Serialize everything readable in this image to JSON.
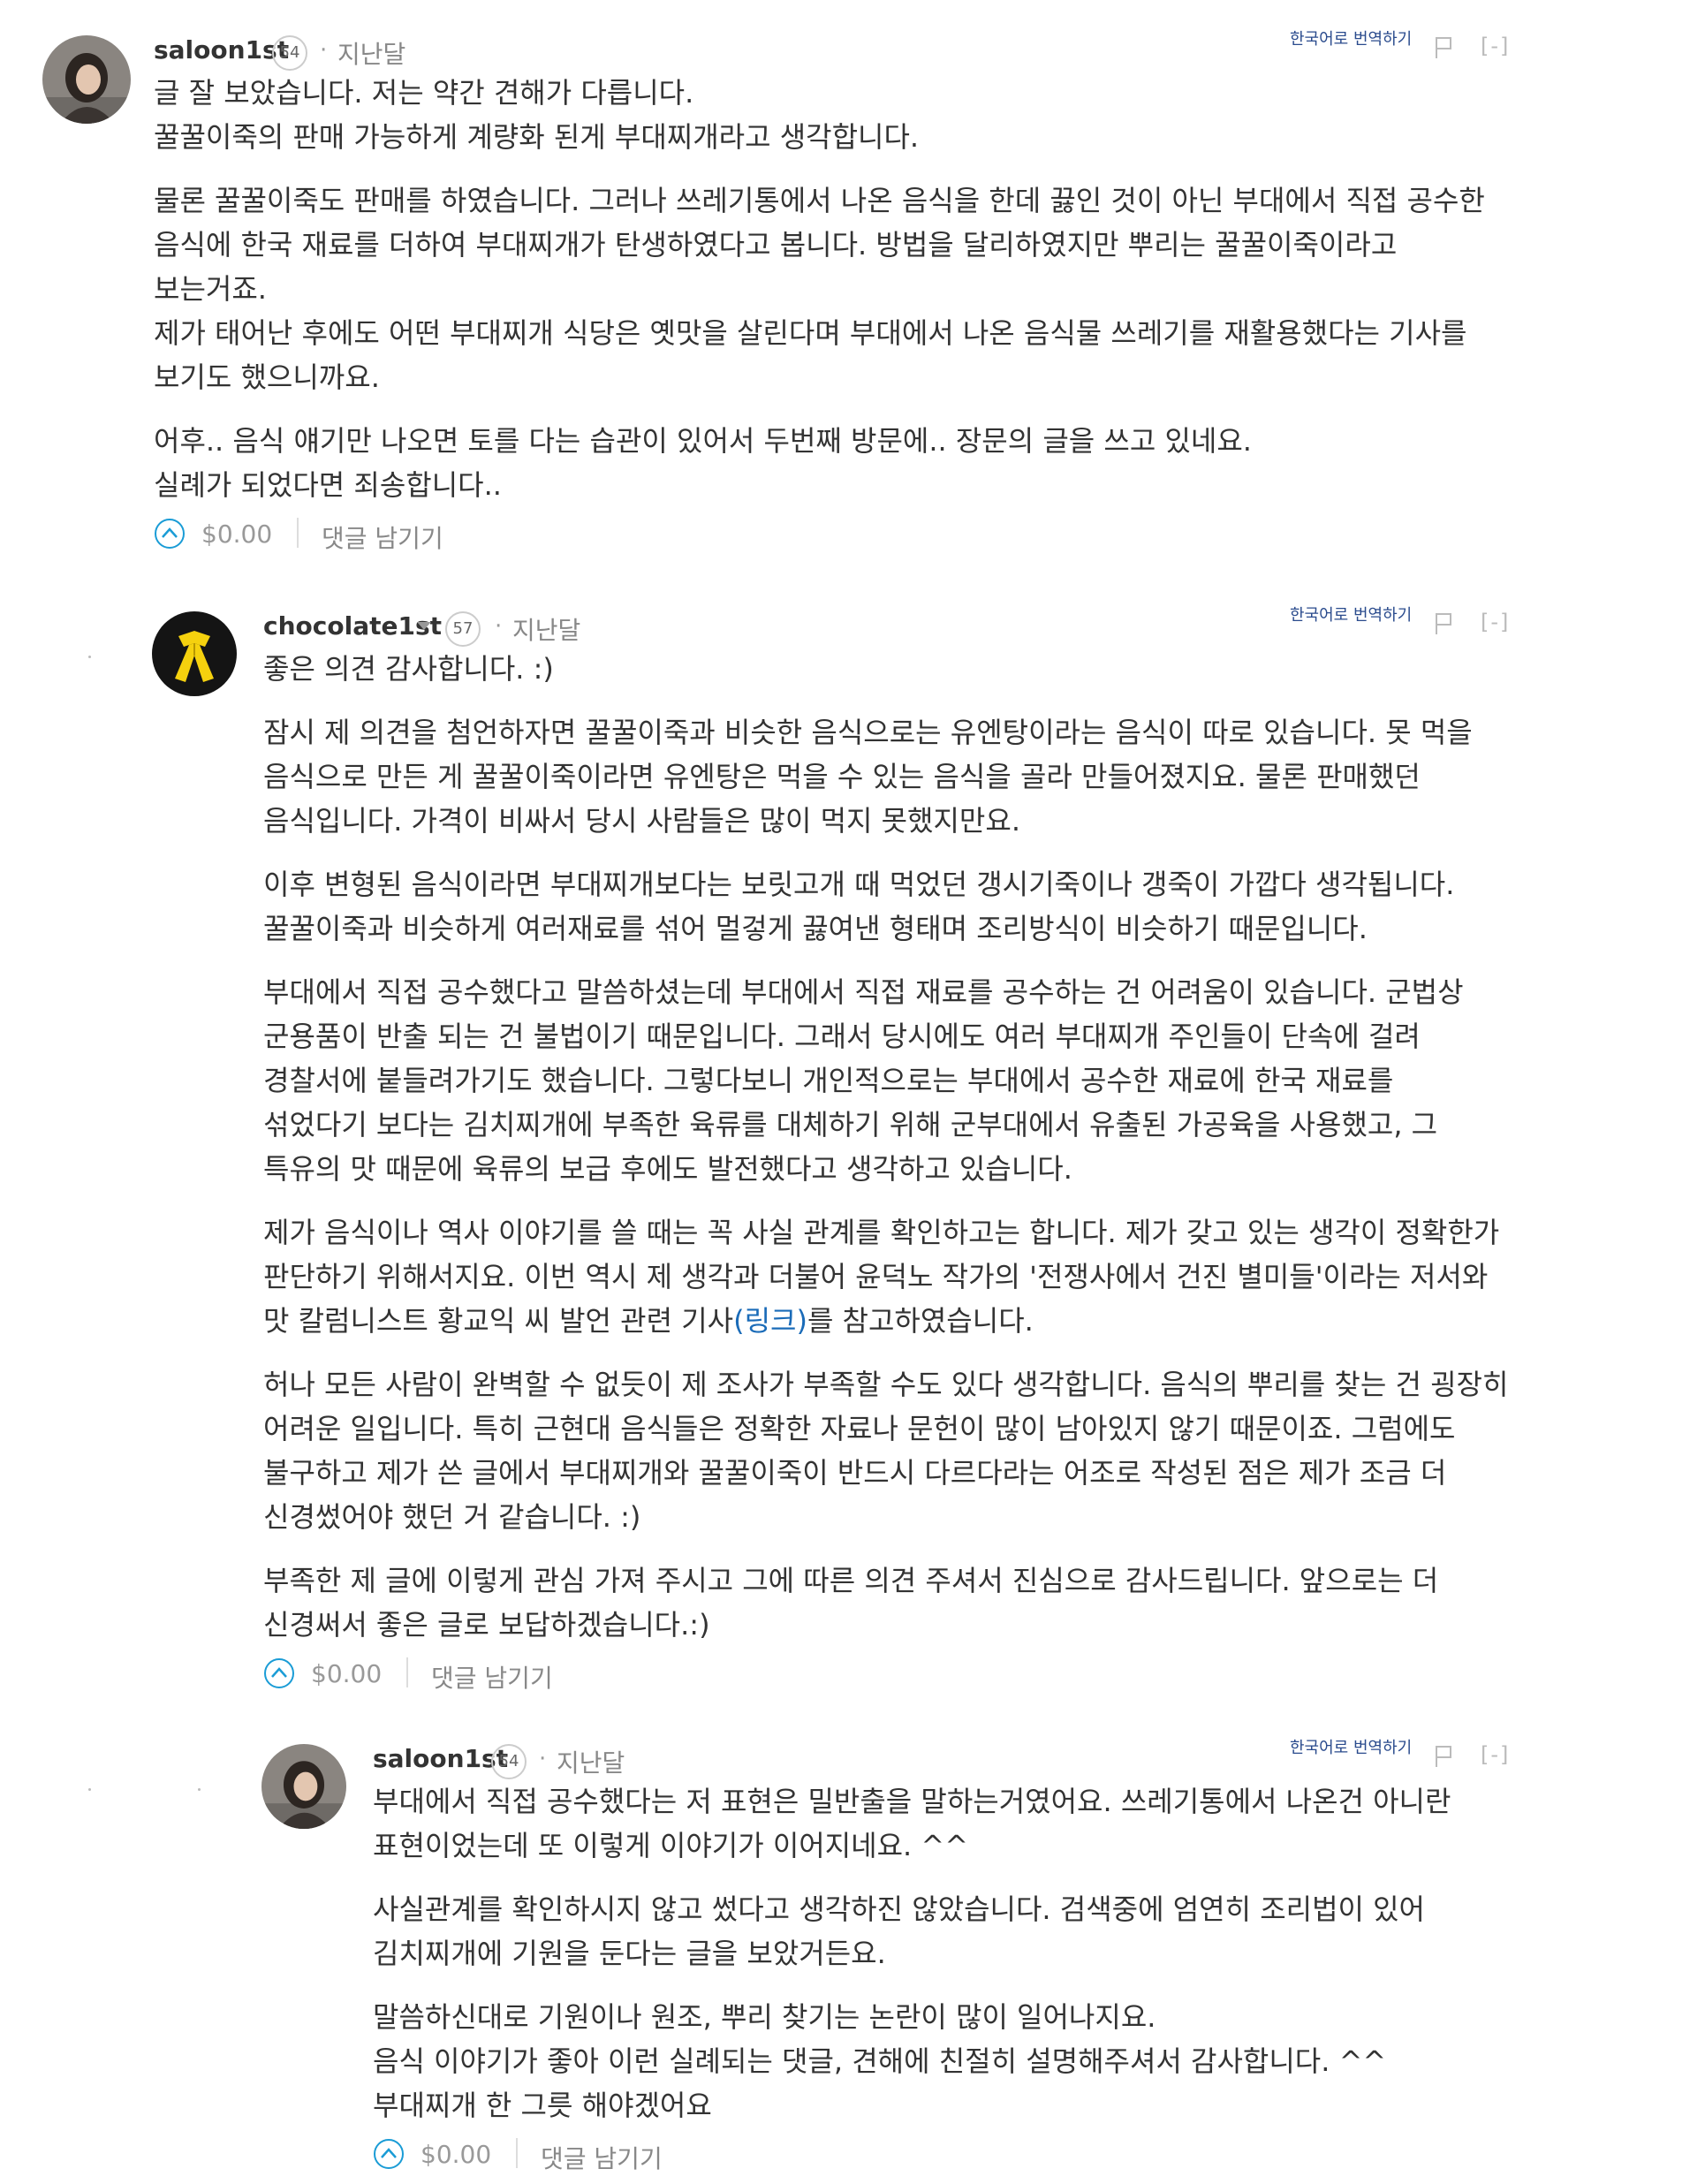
{
  "comments": [
    {
      "author": "saloon1st",
      "reputation": "54",
      "separator": "·",
      "time": "지난달",
      "translate": "한국어로 번역하기",
      "collapse": "[-]",
      "avatar_icon": "user-photo-avatar",
      "body_lines": [
        "글 잘 보았습니다. 저는 약간 견해가 다릅니다.",
        "꿀꿀이죽의 판매 가능하게 계량화 된게 부대찌개라고 생각합니다.",
        "물론 꿀꿀이죽도 판매를 하였습니다. 그러나 쓰레기통에서 나온 음식을 한데 끓인 것이 아닌 부대에서 직접 공수한",
        "음식에 한국 재료를 더하여 부대찌개가 탄생하였다고 봅니다. 방법을 달리하였지만 뿌리는 꿀꿀이죽이라고",
        "보는거죠.",
        "제가 태어난 후에도 어떤 부대찌개 식당은 옛맛을 살린다며 부대에서 나온 음식물 쓰레기를 재활용했다는 기사를",
        "보기도 했으니까요.",
        "어후.. 음식 얘기만 나오면 토를 다는 습관이 있어서 두번째 방문에.. 장문의 글을 쓰고 있네요.",
        "실례가 되었다면 죄송합니다.."
      ],
      "payout": "$0.00",
      "reply_label": "댓글 남기기"
    },
    {
      "author": "chocolate1st",
      "reputation": "57",
      "separator": "·",
      "time": "지난달",
      "translate": "한국어로 번역하기",
      "collapse": "[-]",
      "avatar_icon": "yellow-ribbon-avatar",
      "body_lines": [
        "좋은 의견 감사합니다. :)",
        "잠시 제 의견을 첨언하자면 꿀꿀이죽과 비슷한 음식으로는 유엔탕이라는 음식이 따로 있습니다. 못 먹을",
        "음식으로 만든 게 꿀꿀이죽이라면 유엔탕은 먹을 수 있는 음식을 골라 만들어졌지요. 물론 판매했던",
        "음식입니다. 가격이 비싸서 당시 사람들은 많이 먹지 못했지만요.",
        "이후 변형된 음식이라면 부대찌개보다는 보릿고개 때 먹었던 갱시기죽이나 갱죽이 가깝다 생각됩니다.",
        "꿀꿀이죽과 비슷하게 여러재료를 섞어 멀겋게 끓여낸 형태며 조리방식이 비슷하기 때문입니다.",
        "부대에서 직접 공수했다고 말씀하셨는데 부대에서 직접 재료를 공수하는 건 어려움이 있습니다. 군법상",
        "군용품이 반출 되는 건 불법이기 때문입니다. 그래서 당시에도 여러 부대찌개 주인들이 단속에 걸려",
        "경찰서에 붙들려가기도 했습니다. 그렇다보니 개인적으로는 부대에서 공수한 재료에 한국 재료를",
        "섞었다기 보다는 김치찌개에 부족한 육류를 대체하기 위해 군부대에서 유출된 가공육을 사용했고, 그",
        "특유의 맛 때문에 육류의 보급 후에도 발전했다고 생각하고 있습니다.",
        "제가 음식이나 역사 이야기를 쓸 때는 꼭 사실 관계를 확인하고는 합니다. 제가 갖고 있는 생각이 정확한가",
        "판단하기 위해서지요. 이번 역시 제 생각과 더불어 윤덕노 작가의 '전쟁사에서 건진 별미들'이라는 저서와",
        "맛 칼럼니스트 황교익 씨 발언 관련 기사",
        "허나 모든 사람이 완벽할 수 없듯이 제 조사가 부족할 수도 있다 생각합니다. 음식의 뿌리를 찾는 건 굉장히",
        "어려운 일입니다. 특히 근현대 음식들은 정확한 자료나 문헌이 많이 남아있지 않기 때문이죠. 그럼에도",
        "불구하고 제가 쓴 글에서 부대찌개와 꿀꿀이죽이 반드시 다르다라는 어조로 작성된 점은 제가 조금 더",
        "신경썼어야 했던 거 같습니다. :)",
        "부족한 제 글에 이렇게 관심 가져 주시고 그에 따른 의견 주셔서 진심으로 감사드립니다. 앞으로는 더",
        "신경써서 좋은 글로 보답하겠습니다.:)"
      ],
      "link_open": "(",
      "link_text": "링크",
      "link_close": ")",
      "after_link": "를 참고하였습니다.",
      "payout": "$0.00",
      "reply_label": "댓글 남기기"
    },
    {
      "author": "saloon1st",
      "reputation": "54",
      "separator": "·",
      "time": "지난달",
      "translate": "한국어로 번역하기",
      "collapse": "[-]",
      "avatar_icon": "user-photo-avatar",
      "body_lines": [
        "부대에서 직접 공수했다는 저 표현은 밀반출을 말하는거였어요. 쓰레기통에서 나온건 아니란",
        "표현이었는데 또 이렇게 이야기가 이어지네요. ^^",
        "사실관계를 확인하시지 않고 썼다고 생각하진 않았습니다. 검색중에 엄연히 조리법이 있어",
        "김치찌개에 기원을 둔다는 글을 보았거든요.",
        "말씀하신대로 기원이나 원조, 뿌리 찾기는 논란이 많이 일어나지요.",
        "음식 이야기가 좋아 이런 실례되는 댓글, 견해에 친절히 설명해주셔서 감사합니다. ^^",
        "부대찌개 한 그릇 해야겠어요"
      ],
      "payout": "$0.00",
      "reply_label": "댓글 남기기"
    }
  ]
}
